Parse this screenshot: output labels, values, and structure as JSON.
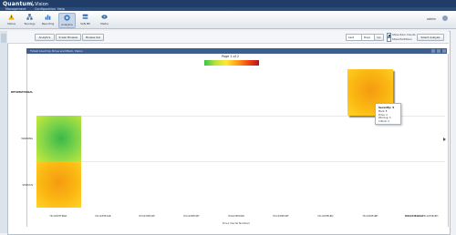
{
  "app": {
    "brand": "Quantum.",
    "title": "Vision"
  },
  "menu": [
    "Management",
    "Configuration",
    "Help"
  ],
  "toolbar": {
    "tools": [
      {
        "label": "Status",
        "icon": "warning-icon",
        "color": "#f0b400"
      },
      {
        "label": "Topology",
        "icon": "topology-icon",
        "color": "#2f6db5"
      },
      {
        "label": "Reporting",
        "icon": "reporting-icon",
        "color": "#2f6db5"
      },
      {
        "label": "Analytics",
        "icon": "analytics-icon",
        "color": "#3a7ccf"
      },
      {
        "label": "SAN MP",
        "icon": "san-icon",
        "color": "#2f6db5"
      },
      {
        "label": "Media",
        "icon": "media-icon",
        "color": "#2f6db5"
      }
    ],
    "user": "admin"
  },
  "controls": {
    "buttons": [
      "Analytics",
      "Scalar Browser",
      "Browse Set"
    ],
    "range_select": "Last",
    "period_select": "Days",
    "go_button": "Go",
    "show_zero_counts": "Show Zero Counts",
    "show_partitions": "Show Partitions",
    "select_analysis_button": "Select Analysis"
  },
  "panel": {
    "title": "Ticket count by Drive and Mark, Vision"
  },
  "chart_data": {
    "type": "heatmap",
    "title": "Page 1 of 2",
    "xlabel": "Drive (Serial Number)",
    "legend_colors": [
      "#39c34a",
      "#b7e23a",
      "#ffe833",
      "#ff9f1a",
      "#f04a16",
      "#b4131b"
    ],
    "rows": [
      "INFORMATIONAL",
      "WARNING",
      "SERIOUS"
    ],
    "columns": [
      "HU1030TTRWA",
      "HU1033E1GB",
      "HU1033E1WP",
      "HU1033E1WF",
      "HU1033E1NW",
      "HU1033E1WF",
      "HU1033E1BQ",
      "HU1033E1BH",
      "HU1033E1ROA",
      "HU1033E1EH"
    ],
    "cells": [
      {
        "row": "WARNING",
        "column": "HU1030TTRWA",
        "color": "green"
      },
      {
        "row": "SERIOUS",
        "column": "HU1030TTRWA",
        "color": "orange"
      },
      {
        "row": "INFORMATIONAL",
        "column": "HU1033E1ROA",
        "color": "orange"
      }
    ]
  },
  "tooltip": {
    "title": "Severity: 5",
    "lines": [
      "Mark: 8",
      "Drive: 2",
      "Warning: 3",
      "Critical: 2"
    ]
  }
}
